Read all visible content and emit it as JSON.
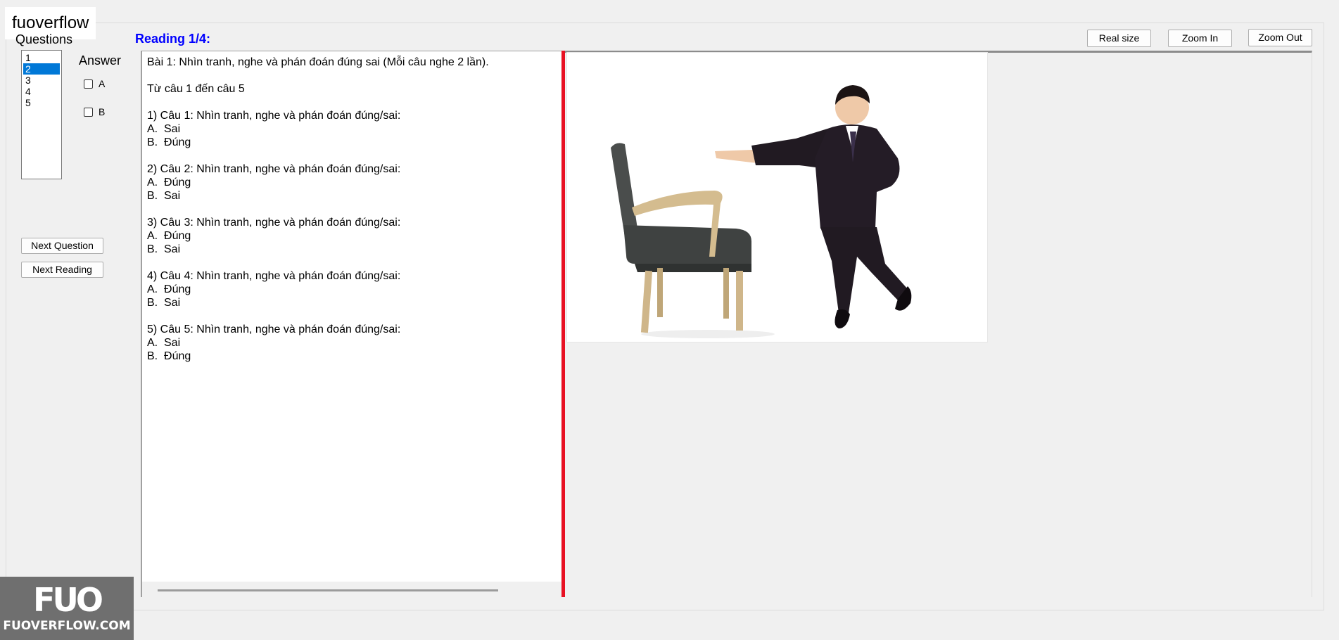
{
  "app": {
    "title": "fuoverflow"
  },
  "sidebar": {
    "questions_label": "Questions",
    "questions": [
      "1",
      "2",
      "3",
      "4",
      "5"
    ],
    "selected_question": "2",
    "answer_label": "Answer",
    "options": [
      "A",
      "B"
    ],
    "next_question_label": "Next Question",
    "next_reading_label": "Next Reading"
  },
  "reading": {
    "title": "Reading 1/4:",
    "text": "Bài 1: Nhìn tranh, nghe và phán đoán đúng sai (Mỗi câu nghe 2 lần).\n\nTừ câu 1 đến câu 5\n\n1) Câu 1: Nhìn tranh, nghe và phán đoán đúng/sai:\nA.  Sai\nB.  Đúng\n\n2) Câu 2: Nhìn tranh, nghe và phán đoán đúng/sai:\nA.  Đúng\nB.  Sai\n\n3) Câu 3: Nhìn tranh, nghe và phán đoán đúng/sai:\nA.  Đúng\nB.  Sai\n\n4) Câu 4: Nhìn tranh, nghe và phán đoán đúng/sai:\nA.  Đúng\nB.  Sai\n\n5) Câu 5: Nhìn tranh, nghe và phán đoán đúng/sai:\nA.  Sai\nB.  Đúng"
  },
  "toolbar": {
    "real_size_label": "Real size",
    "zoom_in_label": "Zoom In",
    "zoom_out_label": "Zoom Out"
  },
  "watermark": {
    "logo": "FUO",
    "site": "FUOVERFLOW.COM"
  },
  "colors": {
    "reading_title": "#0000ff",
    "selection": "#0078d7",
    "splitter": "#e81123"
  }
}
